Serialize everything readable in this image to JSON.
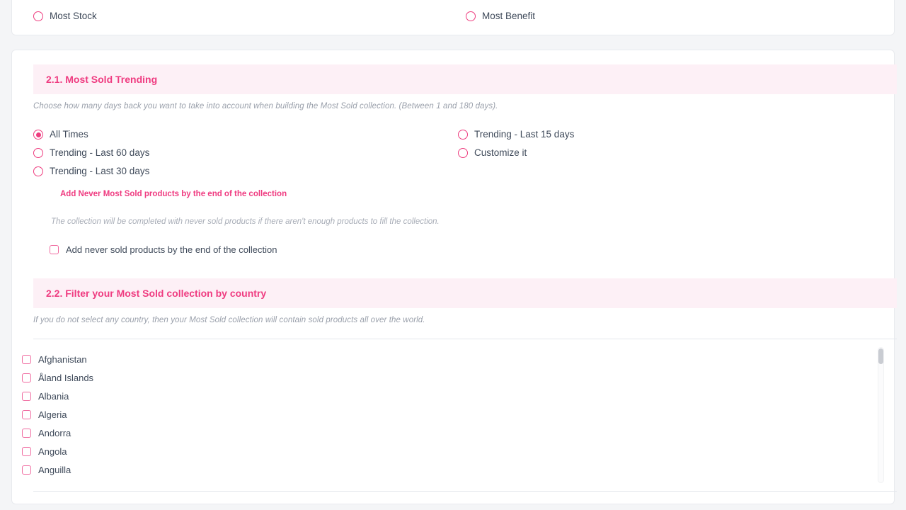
{
  "colors": {
    "accent_pink": "#ef3b80",
    "header_bg": "#fdf0f6",
    "checkbox_border": "#f06ba0",
    "text": "#3f4a5a",
    "muted_italic": "#9aa0ab",
    "page_bg": "#f4f5f7",
    "card_bg": "#ffffff",
    "green_dot": "#8ee0a8"
  },
  "top_card": {
    "options": [
      {
        "label": "Most Stock",
        "checked": false
      },
      {
        "label": "Most Benefit",
        "checked": false
      }
    ]
  },
  "section_trending": {
    "title": "2.1. Most Sold Trending",
    "description": "Choose how many days back you want to take into account when building the Most Sold collection. (Between 1 and 180 days).",
    "options_left": [
      {
        "label": "All Times",
        "checked": true
      },
      {
        "label": "Trending - Last 60 days",
        "checked": false
      },
      {
        "label": "Trending - Last 30 days",
        "checked": false
      }
    ],
    "options_right": [
      {
        "label": "Trending - Last 15 days",
        "checked": false
      },
      {
        "label": "Customize it",
        "checked": false
      }
    ],
    "never_sold": {
      "title": "Add Never Most Sold products by the end of the collection",
      "description": "The collection will be completed with never sold products if there aren't enough products to fill the collection.",
      "checkbox_label": "Add never sold products by the end of the collection",
      "checked": false
    }
  },
  "section_country": {
    "title": "2.2. Filter your Most Sold collection by country",
    "description": "If you do not select any country, then your Most Sold collection will contain sold products all over the world.",
    "countries": [
      {
        "label": "Afghanistan",
        "checked": false
      },
      {
        "label": "Åland Islands",
        "checked": false
      },
      {
        "label": "Albania",
        "checked": false
      },
      {
        "label": "Algeria",
        "checked": false
      },
      {
        "label": "Andorra",
        "checked": false
      },
      {
        "label": "Angola",
        "checked": false
      },
      {
        "label": "Anguilla",
        "checked": false
      }
    ]
  }
}
